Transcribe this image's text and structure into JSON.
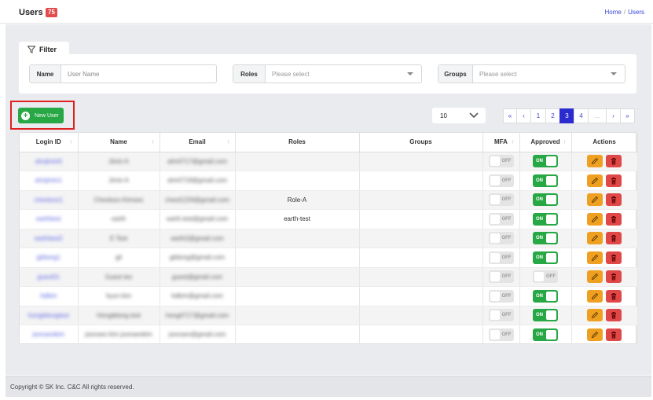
{
  "header": {
    "title": "Users",
    "count_badge": "75",
    "breadcrumb": [
      "Home",
      "Users"
    ],
    "breadcrumb_separator": "/"
  },
  "filter": {
    "tab_label": "Filter",
    "name_label": "Name",
    "name_placeholder": "User Name",
    "roles_label": "Roles",
    "roles_placeholder": "Please select",
    "groups_label": "Groups",
    "groups_placeholder": "Please select"
  },
  "toolbar": {
    "new_user_label": "New User",
    "page_size": "10",
    "pagination": [
      "«",
      "‹",
      "1",
      "2",
      "3",
      "4",
      "...",
      "›",
      "»"
    ],
    "current_page": "3"
  },
  "table": {
    "columns": [
      "Login ID",
      "Name",
      "Email",
      "Roles",
      "Groups",
      "MFA",
      "Approved",
      "Actions"
    ],
    "toggle_on_label": "ON",
    "toggle_off_label": "OFF",
    "rows": [
      {
        "login": "ahnjimin0",
        "name": "Jimin A",
        "email": "ahn0717@gmail.com",
        "roles": "",
        "groups": "",
        "mfa": "OFF",
        "approved": "ON"
      },
      {
        "login": "ahnjimin1",
        "name": "Jimin A",
        "email": "ahn0718@gmail.com",
        "roles": "",
        "groups": "",
        "mfa": "OFF",
        "approved": "ON"
      },
      {
        "login": "cheolsoo1",
        "name": "Cheolsoo Kimseo",
        "email": "cheol1234@gmail.com",
        "roles": "Role-A",
        "groups": "",
        "mfa": "OFF",
        "approved": "ON"
      },
      {
        "login": "earthtest",
        "name": "earth",
        "email": "earth.test@gmail.com",
        "roles": "earth-test",
        "groups": "",
        "mfa": "OFF",
        "approved": "ON"
      },
      {
        "login": "earthtest2",
        "name": "E Test",
        "email": "earth2@gmail.com",
        "roles": "",
        "groups": "",
        "mfa": "OFF",
        "approved": "ON"
      },
      {
        "login": "gildong1",
        "name": "gil",
        "email": "gildong@gmail.com",
        "roles": "",
        "groups": "",
        "mfa": "OFF",
        "approved": "ON"
      },
      {
        "login": "guest01",
        "name": "Guest tes",
        "email": "guest@gmail.com",
        "roles": "",
        "groups": "",
        "mfa": "OFF",
        "approved": "OFF"
      },
      {
        "login": "hdkim",
        "name": "hyun kim",
        "email": "hdkim@gmail.com",
        "roles": "",
        "groups": "",
        "mfa": "OFF",
        "approved": "ON"
      },
      {
        "login": "hongildongtest",
        "name": "Hongildong test",
        "email": "hong0717@gmail.com",
        "roles": "",
        "groups": "",
        "mfa": "OFF",
        "approved": "ON"
      },
      {
        "login": "joonseokim",
        "name": "joonseo kim joonseokim",
        "email": "joonseo@gmail.com",
        "roles": "",
        "groups": "",
        "mfa": "OFF",
        "approved": "ON"
      }
    ]
  },
  "footer": {
    "copyright": "Copyright © SK Inc. C&C All rights reserved."
  },
  "colors": {
    "accent": "#2a2ccf",
    "success": "#28a745",
    "warning": "#f0a020",
    "danger": "#e04848",
    "link": "#3a45d6"
  }
}
